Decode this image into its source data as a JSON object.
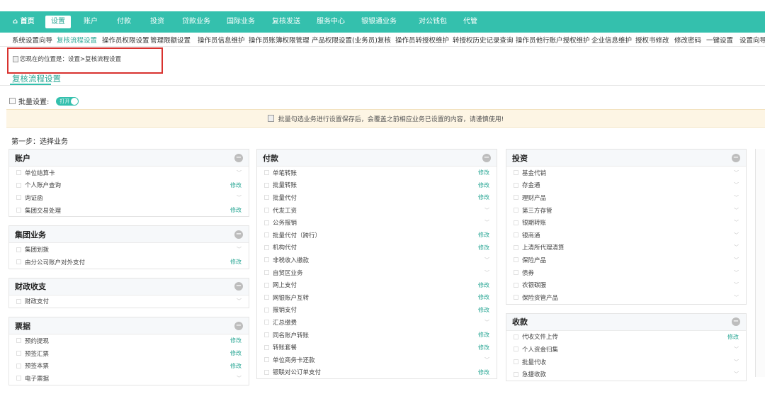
{
  "topnav": {
    "items": [
      {
        "label": "首页",
        "icon": "home-icon"
      },
      {
        "label": "设置",
        "active": true
      },
      {
        "label": "账户"
      },
      {
        "label": "付款"
      },
      {
        "label": "投资"
      },
      {
        "label": "贷款业务"
      },
      {
        "label": "国际业务"
      },
      {
        "label": "复核发送"
      },
      {
        "label": "服务中心"
      },
      {
        "label": "银银通业务"
      },
      {
        "label": "对公钱包"
      },
      {
        "label": "代管"
      }
    ],
    "accent": "#34c0ad"
  },
  "subnav": {
    "items": [
      {
        "label": "系统设置向导"
      },
      {
        "label": "复核流程设置",
        "active": true
      },
      {
        "label": "操作员权限设置"
      },
      {
        "label": "管理限额设置"
      },
      {
        "label": "操作员信息维护"
      },
      {
        "label": "操作员账簿权限管理"
      },
      {
        "label": "产品权限设置(业务员)复核"
      },
      {
        "label": "操作员转授权维护"
      },
      {
        "label": "转授权历史记录查询"
      },
      {
        "label": "操作员他行账户授权维护"
      },
      {
        "label": "企业信息维护"
      },
      {
        "label": "授权书修改"
      },
      {
        "label": "修改密码"
      },
      {
        "label": "一键设置"
      },
      {
        "label": "设置向导"
      }
    ]
  },
  "breadcrumb": {
    "text": "您现在的位置是：设置>复核流程设置",
    "icon": "broken-image-icon"
  },
  "page_title": "复核流程设置",
  "batch": {
    "label": "批量设置:",
    "toggle": "打开"
  },
  "notice": {
    "text": "批量勾选业务进行设置保存后，会覆盖之前相应业务已设置的内容，请谨慎使用!",
    "icon": "broken-image-icon"
  },
  "step": "第一步：选择业务",
  "columns": [
    {
      "sections": [
        {
          "title": "账户",
          "items": [
            {
              "label": "单位结算卡",
              "action": ""
            },
            {
              "label": "个人账户查询",
              "action": "修改"
            },
            {
              "label": "询证函",
              "action": ""
            },
            {
              "label": "集团交易处理",
              "action": "修改"
            }
          ]
        },
        {
          "title": "集团业务",
          "items": [
            {
              "label": "集团划拨",
              "action": ""
            },
            {
              "label": "由分公司账户对外支付",
              "action": "修改"
            }
          ]
        },
        {
          "title": "财政收支",
          "items": [
            {
              "label": "财政支付",
              "action": ""
            }
          ]
        },
        {
          "title": "票据",
          "items": [
            {
              "label": "预约提现",
              "action": "修改"
            },
            {
              "label": "预签汇票",
              "action": "修改"
            },
            {
              "label": "预签本票",
              "action": "修改"
            },
            {
              "label": "电子票据",
              "action": ""
            }
          ]
        }
      ]
    },
    {
      "sections": [
        {
          "title": "付款",
          "items": [
            {
              "label": "单笔转账",
              "action": "修改"
            },
            {
              "label": "批量转账",
              "action": "修改"
            },
            {
              "label": "批量代付",
              "action": "修改"
            },
            {
              "label": "代发工资",
              "action": ""
            },
            {
              "label": "公务报销",
              "action": ""
            },
            {
              "label": "批量代付（跨行）",
              "action": "修改"
            },
            {
              "label": "机构代付",
              "action": "修改"
            },
            {
              "label": "非税收入缴款",
              "action": ""
            },
            {
              "label": "自贸区业务",
              "action": ""
            },
            {
              "label": "网上支付",
              "action": "修改"
            },
            {
              "label": "网银账户互转",
              "action": "修改"
            },
            {
              "label": "报销支付",
              "action": "修改"
            },
            {
              "label": "汇总缴费",
              "action": ""
            },
            {
              "label": "同名账户转账",
              "action": "修改"
            },
            {
              "label": "转账套餐",
              "action": "修改"
            },
            {
              "label": "单位商务卡还款",
              "action": ""
            },
            {
              "label": "银联对公订单支付",
              "action": "修改"
            }
          ]
        }
      ]
    },
    {
      "sections": [
        {
          "title": "投资",
          "items": [
            {
              "label": "基金代销",
              "action": ""
            },
            {
              "label": "存金通",
              "action": ""
            },
            {
              "label": "理财产品",
              "action": ""
            },
            {
              "label": "第三方存管",
              "action": ""
            },
            {
              "label": "银期转账",
              "action": ""
            },
            {
              "label": "银商通",
              "action": ""
            },
            {
              "label": "上清所代理清算",
              "action": ""
            },
            {
              "label": "保险产品",
              "action": ""
            },
            {
              "label": "债券",
              "action": ""
            },
            {
              "label": "农银碳服",
              "action": ""
            },
            {
              "label": "保险资管产品",
              "action": ""
            }
          ]
        },
        {
          "title": "收款",
          "items": [
            {
              "label": "代收文件上传",
              "action": "修改"
            },
            {
              "label": "个人资金归集",
              "action": ""
            },
            {
              "label": "批量代收",
              "action": ""
            },
            {
              "label": "急捷收款",
              "action": ""
            }
          ]
        }
      ]
    }
  ]
}
